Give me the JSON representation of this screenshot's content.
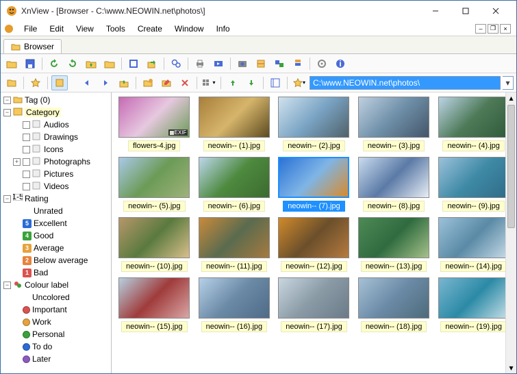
{
  "window": {
    "title": "XnView - [Browser - C:\\www.NEOWIN.net\\photos\\]"
  },
  "menubar": [
    "File",
    "Edit",
    "View",
    "Tools",
    "Create",
    "Window",
    "Info"
  ],
  "tab": {
    "label": "Browser"
  },
  "address": {
    "path": "C:\\www.NEOWIN.net\\photos\\"
  },
  "tree": {
    "tag": {
      "label": "Tag (0)"
    },
    "category": {
      "label": "Category",
      "children": [
        "Audios",
        "Drawings",
        "Icons",
        "Photographs",
        "Pictures",
        "Videos"
      ]
    },
    "rating": {
      "label": "Rating",
      "items": [
        {
          "label": "Unrated",
          "badge": null
        },
        {
          "label": "Excellent",
          "badge": "5",
          "color": "#2b6bd6"
        },
        {
          "label": "Good",
          "badge": "4",
          "color": "#3aa23a"
        },
        {
          "label": "Average",
          "badge": "3",
          "color": "#e6a23c"
        },
        {
          "label": "Below average",
          "badge": "2",
          "color": "#e6833c"
        },
        {
          "label": "Bad",
          "badge": "1",
          "color": "#d9534f"
        }
      ]
    },
    "colour": {
      "label": "Colour label",
      "items": [
        {
          "label": "Uncolored",
          "color": null
        },
        {
          "label": "Important",
          "color": "#d9534f"
        },
        {
          "label": "Work",
          "color": "#e6a23c"
        },
        {
          "label": "Personal",
          "color": "#3aa23a"
        },
        {
          "label": "To do",
          "color": "#2b6bd6"
        },
        {
          "label": "Later",
          "color": "#8a5bbf"
        }
      ]
    }
  },
  "thumbs": [
    {
      "name": "flowers-4.jpg",
      "exif": true,
      "g": [
        "#c76bb5",
        "#e6c8df",
        "#6b9b56"
      ]
    },
    {
      "name": "neowin-- (1).jpg",
      "g": [
        "#a87f3b",
        "#d6b56b",
        "#5c4a1f"
      ]
    },
    {
      "name": "neowin-- (2).jpg",
      "g": [
        "#d0e2ee",
        "#7aa4c4",
        "#50616a"
      ]
    },
    {
      "name": "neowin-- (3).jpg",
      "g": [
        "#bfd0e0",
        "#6e8fa8",
        "#44566a"
      ]
    },
    {
      "name": "neowin-- (4).jpg",
      "g": [
        "#bcd4e6",
        "#4e7a58",
        "#2f5a3a"
      ]
    },
    {
      "name": "neowin-- (5).jpg",
      "g": [
        "#a9c9e8",
        "#6b9b56",
        "#9fb27a"
      ]
    },
    {
      "name": "neowin-- (6).jpg",
      "g": [
        "#bcd7ec",
        "#4e8a3f",
        "#3b6b2f"
      ]
    },
    {
      "name": "neowin-- (7).jpg",
      "selected": true,
      "g": [
        "#2b72d6",
        "#7fb5e6",
        "#d88a2b"
      ]
    },
    {
      "name": "neowin-- (8).jpg",
      "g": [
        "#c9dcef",
        "#5b7aa6",
        "#e8eef5"
      ]
    },
    {
      "name": "neowin-- (9).jpg",
      "g": [
        "#9bc1da",
        "#3f8aa6",
        "#2f6b88"
      ]
    },
    {
      "name": "neowin-- (10).jpg",
      "g": [
        "#b6976a",
        "#5a7a3f",
        "#d9bf8a"
      ]
    },
    {
      "name": "neowin-- (11).jpg",
      "g": [
        "#c98a3b",
        "#5a6b4f",
        "#a67a3f"
      ]
    },
    {
      "name": "neowin-- (12).jpg",
      "g": [
        "#d08a2b",
        "#6b4f2b",
        "#b67a3f"
      ]
    },
    {
      "name": "neowin-- (13).jpg",
      "g": [
        "#4e8a56",
        "#2f6b3f",
        "#a6c18a"
      ]
    },
    {
      "name": "neowin-- (14).jpg",
      "g": [
        "#9bc1da",
        "#5a8aa6",
        "#c9dce8"
      ]
    },
    {
      "name": "neowin-- (15).jpg",
      "g": [
        "#b6d0e0",
        "#a03b3b",
        "#d9a6a6"
      ]
    },
    {
      "name": "neowin-- (16).jpg",
      "g": [
        "#b6d0e8",
        "#6b8aa6",
        "#4e6b88"
      ]
    },
    {
      "name": "neowin-- (17).jpg",
      "g": [
        "#c9d6e0",
        "#8a9ba6",
        "#6b7a88"
      ]
    },
    {
      "name": "neowin-- (18).jpg",
      "g": [
        "#a6c1d6",
        "#6b8aa6",
        "#4e6b7a"
      ]
    },
    {
      "name": "neowin-- (19).jpg",
      "g": [
        "#7ab6d0",
        "#2b8aa6",
        "#c9e0e8"
      ]
    }
  ]
}
